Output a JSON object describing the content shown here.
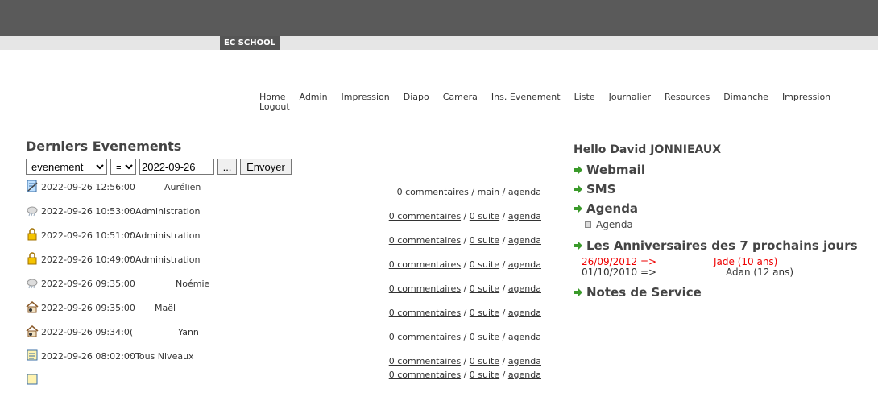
{
  "header": {
    "brand": "EC SCHOOL"
  },
  "nav": {
    "items": [
      "Home",
      "Admin",
      "Impression",
      "Diapo",
      "Camera",
      "Ins. Evenement",
      "Liste",
      "Journalier",
      "Resources",
      "Dimanche",
      "Impression",
      "Logout"
    ]
  },
  "events": {
    "title": "Derniers Evenements",
    "filter": {
      "type": "evenement",
      "operator": "=",
      "date": "2022-09-26",
      "picker_label": "...",
      "submit_label": "Envoyer"
    },
    "rows": [
      {
        "datetime": "2022-09-26 12:56:00",
        "who": "Aurélien",
        "icon": "notepad-icon",
        "links": [
          "0 commentaires",
          "main",
          "agenda"
        ]
      },
      {
        "datetime": "2022-09-26 10:53:00",
        "who": "* Administration",
        "icon": "cloud-icon",
        "links": [
          "0 commentaires",
          "0 suite",
          "agenda"
        ]
      },
      {
        "datetime": "2022-09-26 10:51:00",
        "who": "* Administration",
        "icon": "lock-icon",
        "links": [
          "0 commentaires",
          "0 suite",
          "agenda"
        ]
      },
      {
        "datetime": "2022-09-26 10:49:00",
        "who": "* Administration",
        "icon": "lock-icon",
        "links": [
          "0 commentaires",
          "0 suite",
          "agenda"
        ]
      },
      {
        "datetime": "2022-09-26 09:35:00",
        "who": "Noémie",
        "icon": "cloud-icon",
        "links": [
          "0 commentaires",
          "0 suite",
          "agenda"
        ]
      },
      {
        "datetime": "2022-09-26 09:35:00",
        "who": "Maël",
        "icon": "house-icon",
        "links": [
          "0 commentaires",
          "0 suite",
          "agenda"
        ]
      },
      {
        "datetime": "2022-09-26 09:34:0(",
        "who": "Yann",
        "icon": "house-icon",
        "links": [
          "0 commentaires",
          "0 suite",
          "agenda"
        ]
      },
      {
        "datetime": "2022-09-26 08:02:00",
        "who": "* Tous Niveaux",
        "icon": "note-icon",
        "links": [
          "0 commentaires",
          "0 suite",
          "agenda"
        ]
      },
      {
        "datetime": "",
        "who": "",
        "icon": "note-icon",
        "links": [
          "0 commentaires",
          "0 suite",
          "agenda"
        ]
      }
    ]
  },
  "sidebar": {
    "hello": "Hello David JONNIEAUX",
    "webmail": "Webmail",
    "sms": "SMS",
    "agenda": "Agenda",
    "agenda_sub": "Agenda",
    "birthdays_title": "Les Anniversaires des 7 prochains jours",
    "birthdays": [
      {
        "date": "26/09/2012 =>",
        "name": "Jade (10 ans)",
        "highlight": true
      },
      {
        "date": "01/10/2010 =>",
        "name": "Adan (12 ans)",
        "highlight": false
      }
    ],
    "notes": "Notes de Service"
  },
  "colors": {
    "topbar": "#5a5a5a",
    "arrow": "#3a9a2a",
    "highlight": "#e00000"
  }
}
